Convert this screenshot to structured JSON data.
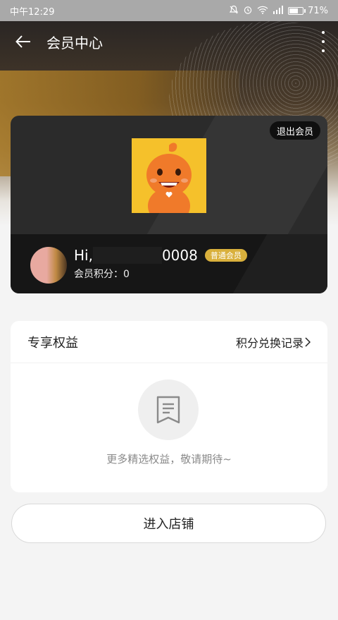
{
  "status_bar": {
    "time": "中午12:29",
    "battery": "71%",
    "battery_level": 0.71
  },
  "toolbar": {
    "title": "会员中心"
  },
  "member_card": {
    "logout_label": "退出会员",
    "greeting_prefix": "Hi,",
    "user_suffix": "0008",
    "level_badge": "普通会员",
    "points_label": "会员积分：0"
  },
  "benefits": {
    "title": "专享权益",
    "records_link": "积分兑换记录",
    "empty_text": "更多精选权益，敬请期待~"
  },
  "enter_store_label": "进入店铺",
  "colors": {
    "badge": "#d9b03c",
    "card": "#2b2b2b",
    "mascot_bg": "#f5c12b"
  }
}
